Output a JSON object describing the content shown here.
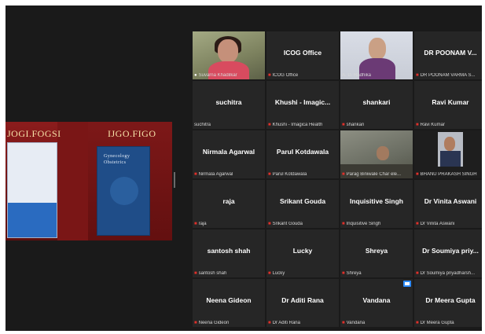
{
  "share": {
    "logo_left": "JOGI.FOGSI",
    "logo_right": "IJGO.FIGO",
    "book_right_title": "Gynecology Obstetrics"
  },
  "participants": [
    {
      "name": "",
      "label": "Suvarna Khadilkar",
      "video": "suvarna",
      "active": true,
      "mic": "microphone-icon"
    },
    {
      "name": "ICOG Office",
      "label": "ICOG Office",
      "video": null,
      "mic": "mic-muted-icon"
    },
    {
      "name": "",
      "label": "A. D. Radhika",
      "video": "radhika",
      "mic": "none"
    },
    {
      "name": "DR POONAM V...",
      "label": "DR POONAM VARMA S...",
      "video": null,
      "mic": "mic-muted-icon"
    },
    {
      "name": "suchitra",
      "label": "suchitra",
      "video": null,
      "mic": "none"
    },
    {
      "name": "Khushi - Imagic...",
      "label": "Khushi - Imagica Health",
      "video": null,
      "mic": "mic-muted-icon"
    },
    {
      "name": "shankari",
      "label": "shankari",
      "video": null,
      "mic": "mic-muted-icon"
    },
    {
      "name": "Ravi Kumar",
      "label": "Ravi Kumar",
      "video": null,
      "mic": "mic-muted-icon"
    },
    {
      "name": "Nirmala Agarwal",
      "label": "Nirmala Agarwal",
      "video": null,
      "mic": "mic-muted-icon"
    },
    {
      "name": "Parul Kotdawala",
      "label": "Parul Kotdawala",
      "video": null,
      "mic": "mic-muted-icon"
    },
    {
      "name": "",
      "label": "Parag Biniwale Char ele...",
      "video": "parag",
      "mic": "mic-muted-icon"
    },
    {
      "name": "",
      "label": "BHANU PRAKASH SINGH",
      "video": "bhanu",
      "mic": "mic-muted-icon"
    },
    {
      "name": "raja",
      "label": "raja",
      "video": null,
      "mic": "mic-muted-icon"
    },
    {
      "name": "Srikant Gouda",
      "label": "Srikant Gouda",
      "video": null,
      "mic": "mic-muted-icon"
    },
    {
      "name": "Inquisitive Singh",
      "label": "Inquisitive Singh",
      "video": null,
      "mic": "mic-muted-icon"
    },
    {
      "name": "Dr Vinita Aswani",
      "label": "Dr Vinita Aswani",
      "video": null,
      "mic": "mic-muted-icon"
    },
    {
      "name": "santosh shah",
      "label": "santosh shah",
      "video": null,
      "mic": "mic-muted-icon"
    },
    {
      "name": "Lucky",
      "label": "Lucky",
      "video": null,
      "mic": "mic-muted-icon"
    },
    {
      "name": "Shreya",
      "label": "Shreya",
      "video": null,
      "mic": "mic-muted-icon"
    },
    {
      "name": "Dr Soumiya priy...",
      "label": "Dr Soumiya priyadharsh...",
      "video": null,
      "mic": "mic-muted-icon"
    },
    {
      "name": "Neena Gideon",
      "label": "Neena Gideon",
      "video": null,
      "mic": "mic-muted-icon"
    },
    {
      "name": "Dr Aditi Rana",
      "label": "Dr Aditi Rana",
      "video": null,
      "mic": "mic-muted-icon"
    },
    {
      "name": "Vandana",
      "label": "Vandana",
      "video": null,
      "mic": "mic-muted-icon",
      "camera_badge": "camera-icon"
    },
    {
      "name": "Dr Meera Gupta",
      "label": "Dr Meera Gupta",
      "video": null,
      "mic": "mic-muted-icon"
    }
  ]
}
